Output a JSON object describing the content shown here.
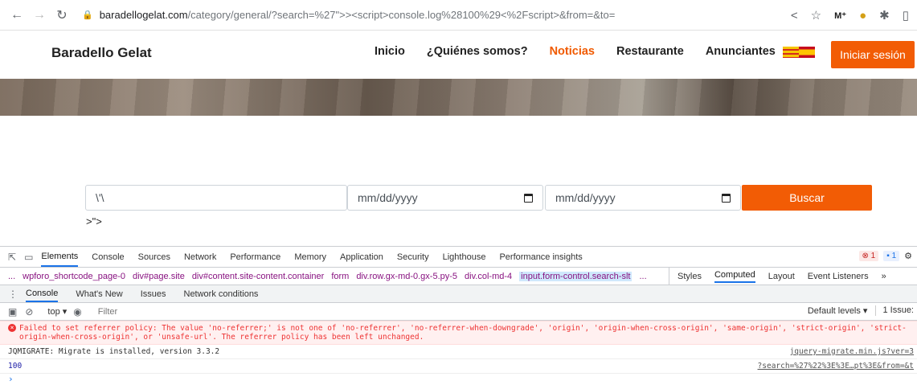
{
  "browser": {
    "url_host": "baradellogelat.com",
    "url_rest": "/category/general/?search=%27\">><script>console.log%28100%29<%2Fscript>&from=&to="
  },
  "site": {
    "brand": "Baradello Gelat",
    "nav": [
      "Inicio",
      "¿Quiénes somos?",
      "Noticias",
      "Restaurante",
      "Anunciantes"
    ],
    "active_nav": "Noticias",
    "login_label": "Iniciar sesión",
    "accent_color": "#f25c05"
  },
  "search_form": {
    "search_value": "\\'\\",
    "date_from_placeholder": "mm/dd/yyyy",
    "date_to_placeholder": "mm/dd/yyyy",
    "button_label": "Buscar",
    "injected_text": ">\">"
  },
  "devtools": {
    "tabs": [
      "Elements",
      "Console",
      "Sources",
      "Network",
      "Performance",
      "Memory",
      "Application",
      "Security",
      "Lighthouse",
      "Performance insights"
    ],
    "active_tab": "Elements",
    "error_count": "1",
    "info_count": "1",
    "breadcrumb": [
      "...",
      "wpforo_shortcode_page-0",
      "div#page.site",
      "div#content.site-content.container",
      "form",
      "div.row.gx-md-0.gx-5.py-5",
      "div.col-md-4",
      "input.form-control.search-slt",
      "..."
    ],
    "side_tabs": [
      "Styles",
      "Computed",
      "Layout",
      "Event Listeners",
      "»"
    ],
    "active_side_tab": "Computed",
    "drawer_tabs": [
      "Console",
      "What's New",
      "Issues",
      "Network conditions"
    ],
    "active_drawer_tab": "Console",
    "context": "top ▾",
    "filter_placeholder": "Filter",
    "default_levels": "Default levels ▾",
    "issues": "1 Issue:",
    "messages": {
      "error": "Failed to set referrer policy: The value 'no-referrer;' is not one of 'no-referrer', 'no-referrer-when-downgrade', 'origin', 'origin-when-cross-origin', 'same-origin', 'strict-origin', 'strict-origin-when-cross-origin', or 'unsafe-url'. The referrer policy has been left unchanged.",
      "jqmigrate": "JQMIGRATE: Migrate is installed, version 3.3.2",
      "jqmigrate_src": "jquery-migrate.min.js?ver=3",
      "log_value": "100",
      "log_src": "?search=%27%22%3E%3E…pt%3E&from=&t"
    }
  }
}
